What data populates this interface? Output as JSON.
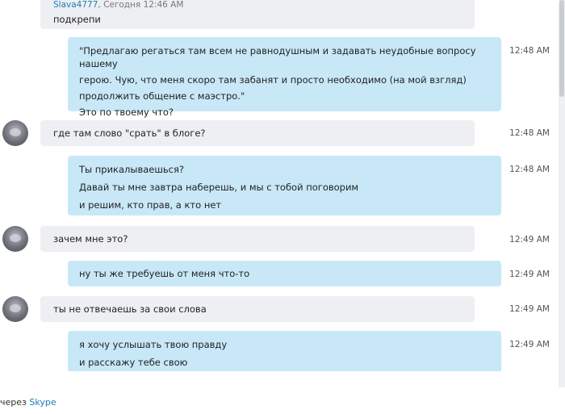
{
  "messages": [
    {
      "sender": "Slava4777",
      "meta": ", Сегодня 12:46 AM",
      "lines": [
        "подкрепи"
      ]
    },
    {
      "lines": [
        "\"Предлагаю регаться там всем не равнодушным и задавать неудобные вопросу нашему",
        "герою. Чую, что меня скоро там забанят и просто необходимо (на мой взгляд)",
        "продолжить общение с маэстро.\"",
        "Это по твоему что?"
      ],
      "time": "12:48 AM"
    },
    {
      "lines": [
        "где там слово \"срать\" в блоге?"
      ],
      "time": "12:48 AM"
    },
    {
      "lines": [
        "Ты прикалываешься?",
        "Давай ты мне завтра наберешь, и мы с тобой поговорим",
        "и решим, кто прав, а кто нет"
      ],
      "time": "12:48 AM"
    },
    {
      "lines": [
        "зачем мне это?"
      ],
      "time": "12:49 AM"
    },
    {
      "lines": [
        "ну ты же требуешь от меня что-то"
      ],
      "time": "12:49 AM"
    },
    {
      "lines": [
        "ты не отвечаешь за свои слова"
      ],
      "time": "12:49 AM"
    },
    {
      "lines": [
        "я хочу услышать твою правду",
        "и расскажу тебе свою"
      ],
      "time": "12:49 AM"
    }
  ],
  "footer": {
    "prefix": "через ",
    "link": "Skype"
  }
}
